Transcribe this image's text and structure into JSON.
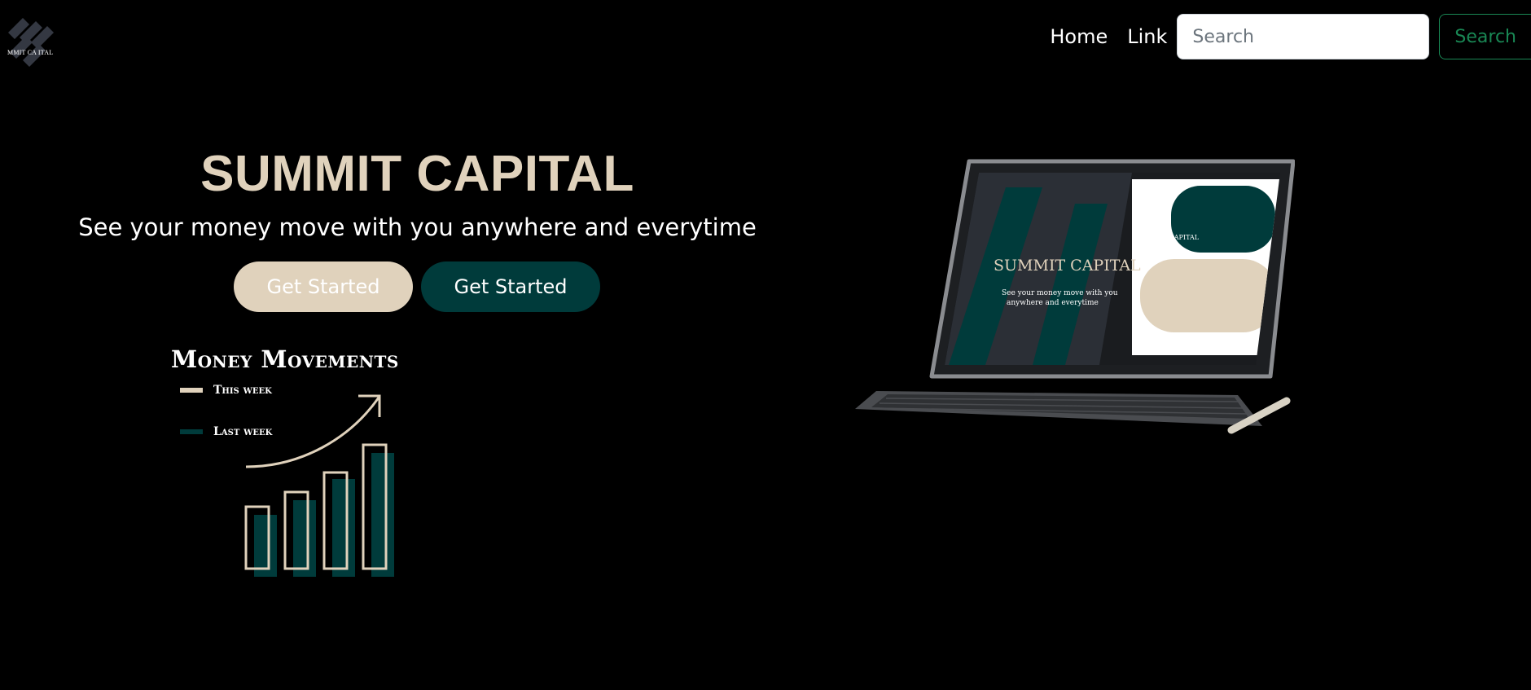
{
  "brand": {
    "logo_text": "MMIT CA ITAL"
  },
  "nav": {
    "home": "Home",
    "link": "Link",
    "search_placeholder": "Search",
    "search_button": "Search"
  },
  "hero": {
    "title": "SUMMIT CAPITAL",
    "subtitle": "See your money move with you anywhere and everytime",
    "primary_button": "Get Started",
    "secondary_button": "Get Started"
  },
  "money_movements": {
    "title": "Money Movements",
    "legend": [
      {
        "label": "This week",
        "color": "#e0d2bc"
      },
      {
        "label": "Last week",
        "color": "#003b3b"
      }
    ]
  },
  "tablet_screen": {
    "title": "SUMMIT CAPITAL",
    "subtitle_line1": "See your money move with you",
    "subtitle_line2": "anywhere and everytime",
    "logo_text": "SUMMIT CAPITAL"
  },
  "colors": {
    "accent_beige": "#e0d2bc",
    "accent_teal": "#003b3b",
    "search_green": "#198754",
    "background": "#000000"
  }
}
